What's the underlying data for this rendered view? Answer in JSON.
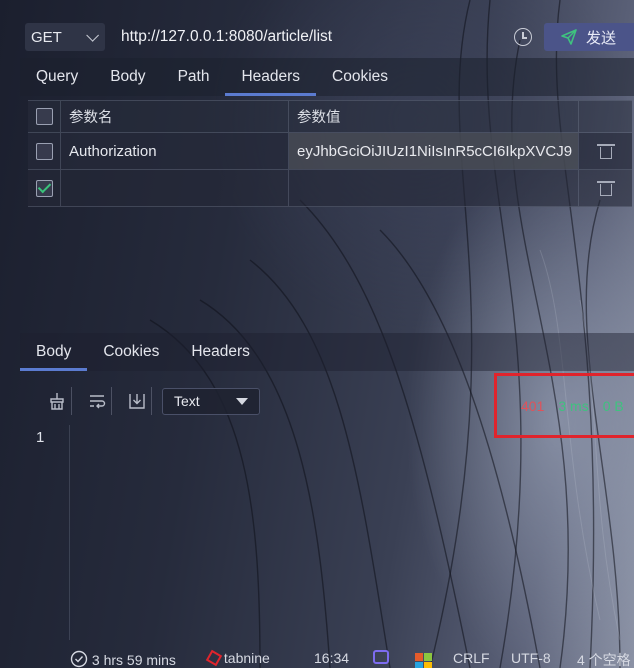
{
  "request": {
    "method": "GET",
    "url": "http://127.0.0.1:8080/article/list",
    "send_label": "发送"
  },
  "request_tabs": [
    "Query",
    "Body",
    "Path",
    "Headers",
    "Cookies"
  ],
  "request_active_tab": "Headers",
  "headers_table": {
    "col_name": "参数名",
    "col_value": "参数值",
    "rows": [
      {
        "name": "Authorization",
        "value": "eyJhbGciOiJIUzI1NiIsInR5cCI6IkpXVCJ9",
        "checked": false
      },
      {
        "name": "",
        "value": "",
        "checked": true
      }
    ]
  },
  "response_tabs": [
    "Body",
    "Cookies",
    "Headers"
  ],
  "response_active_tab": "Body",
  "response": {
    "format": "Text",
    "status_code": "401",
    "time": "3 ms",
    "size": "0 B",
    "line_number": "1"
  },
  "status_bar": {
    "time_tracked": "3 hrs 59 mins",
    "plugin": "tabnine",
    "clock": "16:34",
    "line_ending": "CRLF",
    "encoding": "UTF-8",
    "indent": "4 个空格"
  },
  "colors": {
    "accent_tab": "#5b7bd0",
    "send_button": "#4b5489",
    "status_error": "#e0525a",
    "status_ok": "#3fc27f",
    "highlight_box": "#e0242c"
  },
  "icons": [
    "clock-icon",
    "send-icon",
    "trash-icon",
    "broom-icon",
    "wrap-icon",
    "download-icon",
    "dropdown-arrow-icon"
  ]
}
